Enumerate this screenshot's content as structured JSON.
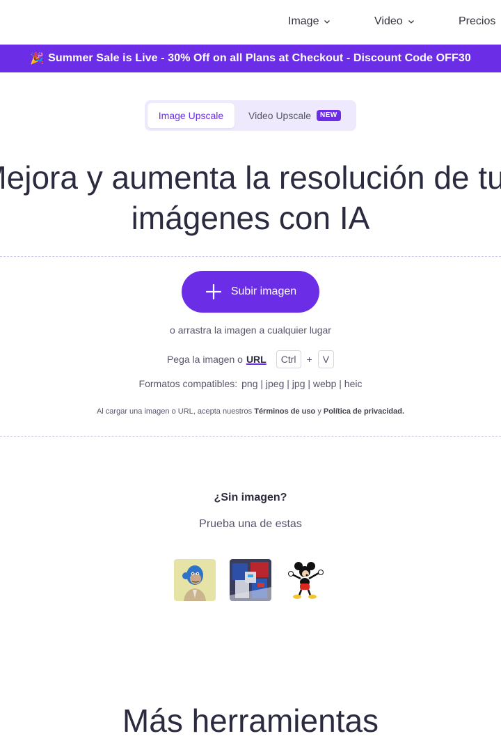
{
  "nav": {
    "image_label": "Image",
    "video_label": "Video",
    "pricing_label": "Precios"
  },
  "banner": {
    "emoji": "🎉",
    "text": "Summer Sale is Live - 30% Off on all Plans at Checkout - Discount Code OFF30"
  },
  "tabs": {
    "image_upscale": "Image Upscale",
    "video_upscale": "Video Upscale",
    "new_badge": "NEW"
  },
  "hero": {
    "line1": "Mejora y aumenta la resolución de tus",
    "line2": "imágenes con IA"
  },
  "upload": {
    "button_label": "Subir imagen",
    "drag_text": "o arrastra la imagen a cualquier lugar",
    "paste_text": "Pega la imagen o",
    "url_label": "URL",
    "key_ctrl": "Ctrl",
    "key_plus": "+",
    "key_v": "V",
    "formats_label": "Formatos compatibles:",
    "formats_list": "png | jpeg | jpg | webp | heic",
    "terms_prefix": "Al cargar una imagen o URL, acepta nuestros",
    "terms_link": "Términos de uso",
    "terms_and": "y",
    "privacy_link": "Política de privacidad."
  },
  "samples": {
    "title": "¿Sin imagen?",
    "subtitle": "Prueba una de estas",
    "images": [
      "ape-sample-image",
      "robot-sample-image",
      "mickey-sample-image"
    ]
  },
  "more_tools": {
    "title": "Más herramientas"
  },
  "colors": {
    "accent": "#6b2ee6",
    "tab_bg": "#efe9fd",
    "text_dark": "#2b2b40",
    "text_muted": "#55556a"
  }
}
